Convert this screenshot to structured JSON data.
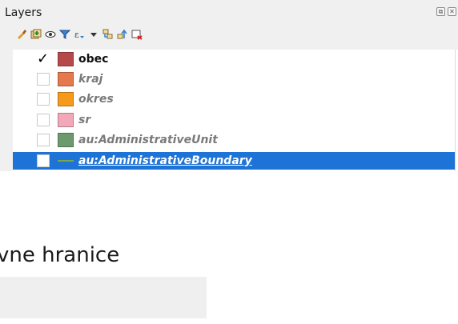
{
  "panel": {
    "title": "Layers",
    "controls": [
      {
        "name": "float-panel-icon",
        "glyph": "⧉"
      },
      {
        "name": "close-panel-icon",
        "glyph": "✕"
      }
    ]
  },
  "toolbar": {
    "buttons": [
      {
        "name": "style-manager-icon"
      },
      {
        "name": "add-group-icon"
      },
      {
        "name": "manage-visibility-icon"
      },
      {
        "name": "filter-legend-icon"
      },
      {
        "name": "filter-by-expression-icon"
      },
      {
        "name": "dropdown-arrow-icon"
      },
      {
        "name": "expand-all-icon"
      },
      {
        "name": "collapse-all-icon"
      },
      {
        "name": "remove-layer-icon"
      }
    ]
  },
  "layers": [
    {
      "name": "obec",
      "checked": true,
      "symbol": "fill",
      "color": "#b64a4a",
      "active": true,
      "selected": false
    },
    {
      "name": "kraj",
      "checked": false,
      "symbol": "fill",
      "color": "#e5794c",
      "active": false,
      "selected": false
    },
    {
      "name": "okres",
      "checked": false,
      "symbol": "fill",
      "color": "#f59a1a",
      "active": false,
      "selected": false
    },
    {
      "name": "sr",
      "checked": false,
      "symbol": "fill",
      "color": "#f2a8b8",
      "active": false,
      "selected": false
    },
    {
      "name": "au:AdministrativeUnit",
      "checked": false,
      "symbol": "fill",
      "color": "#6c9a6e",
      "active": false,
      "selected": false
    },
    {
      "name": "au:AdministrativeBoundary",
      "checked": false,
      "symbol": "line",
      "color": "#7aa54c",
      "active": false,
      "selected": true
    }
  ],
  "form": {
    "heading": "vne hranice",
    "field_value": ""
  },
  "colors": {
    "selection": "#1e74d6",
    "panel_bg": "#f0f0f0"
  }
}
